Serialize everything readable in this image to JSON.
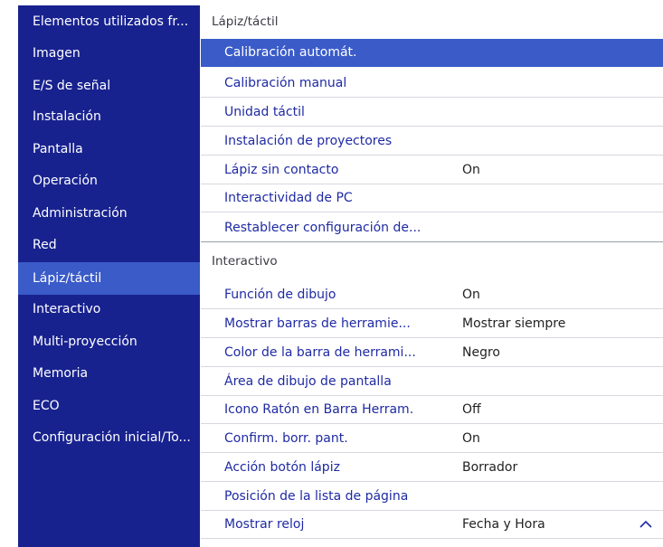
{
  "sidebar": {
    "items": [
      {
        "label": "Elementos utilizados fr..."
      },
      {
        "label": "Imagen"
      },
      {
        "label": "E/S de señal"
      },
      {
        "label": "Instalación"
      },
      {
        "label": "Pantalla"
      },
      {
        "label": "Operación"
      },
      {
        "label": "Administración"
      },
      {
        "label": "Red"
      },
      {
        "label": "Lápiz/táctil",
        "selected": true
      },
      {
        "label": "Interactivo"
      },
      {
        "label": "Multi-proyección"
      },
      {
        "label": "Memoria"
      },
      {
        "label": "ECO"
      },
      {
        "label": "Configuración inicial/To..."
      }
    ]
  },
  "main": {
    "sections": [
      {
        "title": "Lápiz/táctil",
        "rows": [
          {
            "label": "Calibración automát.",
            "value": "",
            "selected": true
          },
          {
            "label": "Calibración manual",
            "value": ""
          },
          {
            "label": "Unidad táctil",
            "value": ""
          },
          {
            "label": "Instalación de proyectores",
            "value": ""
          },
          {
            "label": "Lápiz sin contacto",
            "value": "On"
          },
          {
            "label": "Interactividad de PC",
            "value": ""
          },
          {
            "label": "Restablecer configuración de...",
            "value": ""
          }
        ]
      },
      {
        "title": "Interactivo",
        "rows": [
          {
            "label": "Función de dibujo",
            "value": "On"
          },
          {
            "label": "Mostrar barras de herramie...",
            "value": "Mostrar siempre"
          },
          {
            "label": "Color de la barra de herrami...",
            "value": "Negro"
          },
          {
            "label": "Área de dibujo de pantalla",
            "value": ""
          },
          {
            "label": "Icono Ratón en Barra Herram.",
            "value": "Off"
          },
          {
            "label": "Confirm. borr. pant.",
            "value": "On"
          },
          {
            "label": "Acción botón lápiz",
            "value": "Borrador"
          },
          {
            "label": "Posición de la lista de página",
            "value": ""
          },
          {
            "label": "Mostrar reloj",
            "value": "Fecha y Hora"
          }
        ]
      }
    ],
    "scroll_icon": "chevron-up-icon"
  },
  "colors": {
    "sidebar_bg": "#18228f",
    "selection": "#3a5bc8",
    "label_text": "#1f2aa3",
    "value_text": "#222222"
  }
}
